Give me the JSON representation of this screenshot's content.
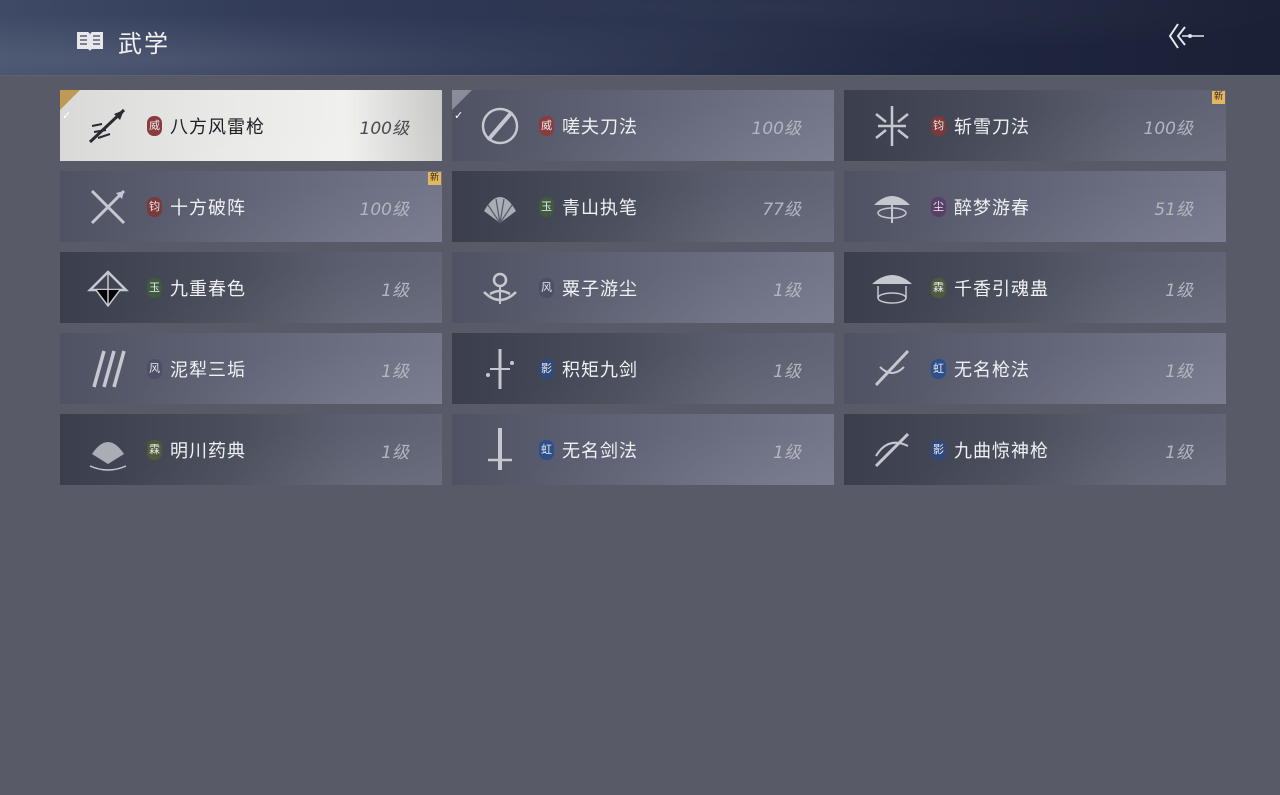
{
  "header": {
    "title": "武学",
    "icon": "book-icon",
    "back_icon": "back-arrow-icon"
  },
  "colors": {
    "selected_check": "#bf9a55",
    "new_badge": "#e3b661",
    "badge_wei": "#8a3b3b",
    "badge_jun": "#7b3a3a",
    "badge_yu": "#3f5a3f",
    "badge_chen": "#5a3f6a",
    "badge_feng": "#4e4e66",
    "badge_lin": "#505a3a",
    "badge_ying": "#2f4a7a",
    "badge_hong": "#2d4f8a"
  },
  "skills": [
    {
      "name": "八方风雷枪",
      "level": "100级",
      "badge": "威",
      "badge_color": "#8a3b3b",
      "icon": "spear-icon",
      "selected": true,
      "checked": true,
      "new": false
    },
    {
      "name": "嗟夫刀法",
      "level": "100级",
      "badge": "威",
      "badge_color": "#8a3b3b",
      "icon": "blade-circle-icon",
      "selected": false,
      "checked": true,
      "new": false
    },
    {
      "name": "斩雪刀法",
      "level": "100级",
      "badge": "钧",
      "badge_color": "#7b3a3a",
      "icon": "snow-blade-icon",
      "selected": false,
      "checked": false,
      "new": true
    },
    {
      "name": "十方破阵",
      "level": "100级",
      "badge": "钧",
      "badge_color": "#7b3a3a",
      "icon": "crossed-spears-icon",
      "selected": false,
      "checked": false,
      "new": true
    },
    {
      "name": "青山执笔",
      "level": "77级",
      "badge": "玉",
      "badge_color": "#3f5a3f",
      "icon": "fan-icon",
      "selected": false,
      "checked": false,
      "new": false
    },
    {
      "name": "醉梦游春",
      "level": "51级",
      "badge": "尘",
      "badge_color": "#5a3f6a",
      "icon": "umbrella-icon",
      "selected": false,
      "checked": false,
      "new": false
    },
    {
      "name": "九重春色",
      "level": "1级",
      "badge": "玉",
      "badge_color": "#3f5a3f",
      "icon": "parasol-icon",
      "selected": false,
      "checked": false,
      "new": false
    },
    {
      "name": "粟子游尘",
      "level": "1级",
      "badge": "风",
      "badge_color": "#4e4e66",
      "icon": "lotus-icon",
      "selected": false,
      "checked": false,
      "new": false
    },
    {
      "name": "千香引魂蛊",
      "level": "1级",
      "badge": "霖",
      "badge_color": "#505a3a",
      "icon": "hat-icon",
      "selected": false,
      "checked": false,
      "new": false
    },
    {
      "name": "泥犁三垢",
      "level": "1级",
      "badge": "风",
      "badge_color": "#4e4e66",
      "icon": "claws-icon",
      "selected": false,
      "checked": false,
      "new": false
    },
    {
      "name": "积矩九剑",
      "level": "1级",
      "badge": "影",
      "badge_color": "#2f4a7a",
      "icon": "sword-dots-icon",
      "selected": false,
      "checked": false,
      "new": false
    },
    {
      "name": "无名枪法",
      "level": "1级",
      "badge": "虹",
      "badge_color": "#2d4f8a",
      "icon": "spear-swirl-icon",
      "selected": false,
      "checked": false,
      "new": false
    },
    {
      "name": "明川药典",
      "level": "1级",
      "badge": "霖",
      "badge_color": "#505a3a",
      "icon": "herb-fan-icon",
      "selected": false,
      "checked": false,
      "new": false
    },
    {
      "name": "无名剑法",
      "level": "1级",
      "badge": "虹",
      "badge_color": "#2d4f8a",
      "icon": "sword-icon",
      "selected": false,
      "checked": false,
      "new": false
    },
    {
      "name": "九曲惊神枪",
      "level": "1级",
      "badge": "影",
      "badge_color": "#2f4a7a",
      "icon": "twisted-spear-icon",
      "selected": false,
      "checked": false,
      "new": false
    }
  ],
  "labels": {
    "new_badge": "新",
    "check_mark": "✓"
  }
}
